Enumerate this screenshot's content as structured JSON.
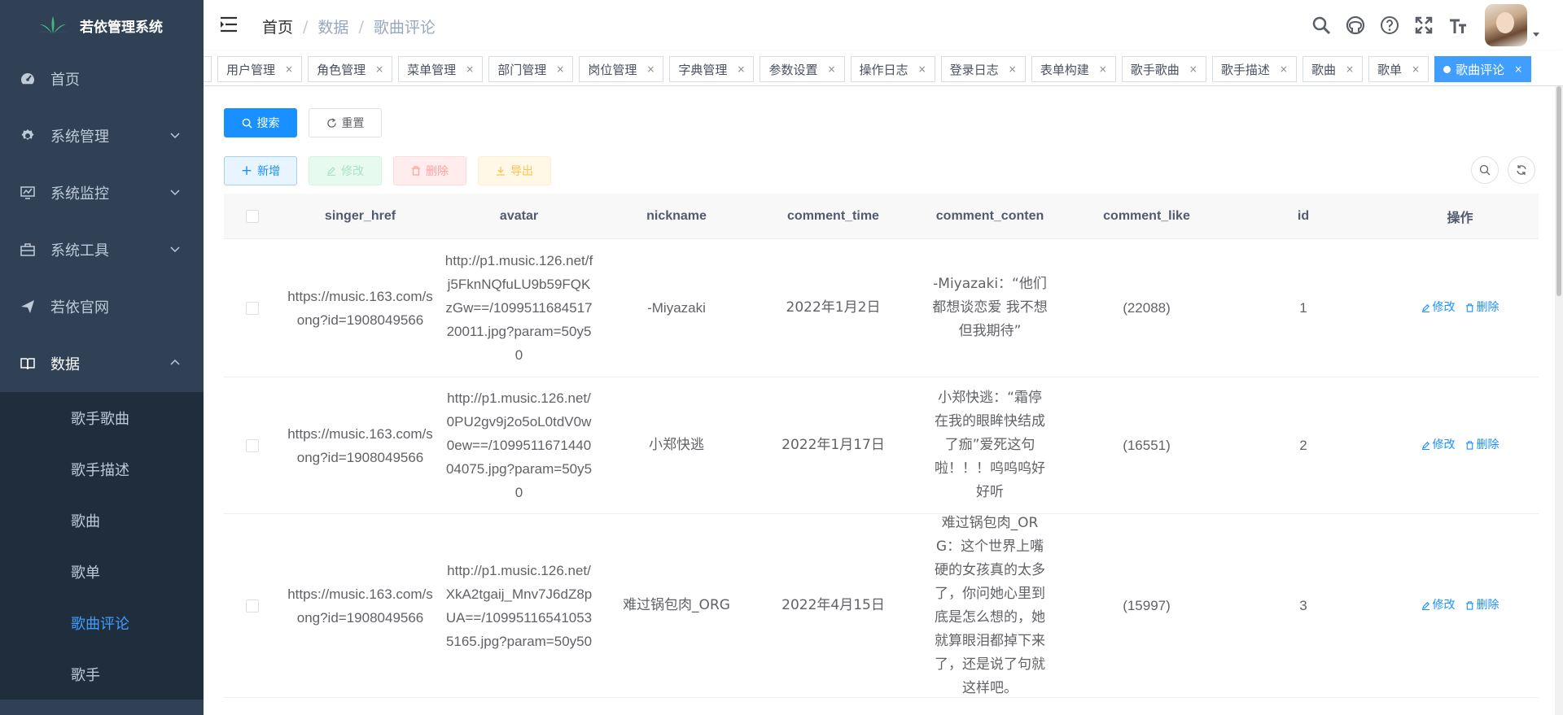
{
  "app": {
    "title": "若依管理系统"
  },
  "sidebar": {
    "items": [
      {
        "label": "首页",
        "icon": "dashboard-icon"
      },
      {
        "label": "系统管理",
        "icon": "gear-icon"
      },
      {
        "label": "系统监控",
        "icon": "monitor-icon"
      },
      {
        "label": "系统工具",
        "icon": "toolbox-icon"
      },
      {
        "label": "若依官网",
        "icon": "send-icon"
      },
      {
        "label": "数据",
        "icon": "book-icon"
      }
    ],
    "submenu": [
      "歌手歌曲",
      "歌手描述",
      "歌曲",
      "歌单",
      "歌曲评论",
      "歌手"
    ]
  },
  "breadcrumb": {
    "first": "首页",
    "sep": "/",
    "mid": "数据",
    "last": "歌曲评论"
  },
  "tags": [
    "用户管理",
    "角色管理",
    "菜单管理",
    "部门管理",
    "岗位管理",
    "字典管理",
    "参数设置",
    "操作日志",
    "登录日志",
    "表单构建",
    "歌手歌曲",
    "歌手描述",
    "歌曲",
    "歌单",
    "歌曲评论"
  ],
  "search": {
    "search_label": "搜索",
    "reset_label": "重置"
  },
  "toolbar": {
    "add_label": "新增",
    "edit_label": "修改",
    "delete_label": "删除",
    "export_label": "导出"
  },
  "table": {
    "headers": [
      "singer_href",
      "avatar",
      "nickname",
      "comment_time",
      "comment_conten",
      "comment_like",
      "id",
      "操作"
    ],
    "rows": [
      {
        "singer_href": "https://music.163.com/song?id=1908049566",
        "avatar": "http://p1.music.126.net/fj5FknNQfuLU9b59FQKzGw==/109951168451720011.jpg?param=50y50",
        "nickname": "-Miyazaki",
        "comment_time": "2022年1月2日",
        "comment_conten": "-Miyazaki：“他们都想谈恋爱 我不想 但我期待”",
        "comment_like": "(22088)",
        "id": "1"
      },
      {
        "singer_href": "https://music.163.com/song?id=1908049566",
        "avatar": "http://p1.music.126.net/0PU2gv9j2o5oL0tdV0w0ew==/109951167144004075.jpg?param=50y50",
        "nickname": "小郑快逃",
        "comment_time": "2022年1月17日",
        "comment_conten": "小郑快逃：“霜停在我的眼眸快结成了痂”爱死这句啦！！！呜呜呜好好听",
        "comment_like": "(16551)",
        "id": "2"
      },
      {
        "singer_href": "https://music.163.com/song?id=1908049566",
        "avatar": "http://p1.music.126.net/XkA2tgaij_Mnv7J6dZ8pUA==/109951165410535165.jpg?param=50y50",
        "nickname": "难过锅包肉_ORG",
        "comment_time": "2022年4月15日",
        "comment_conten": "难过锅包肉_ORG：这个世界上嘴硬的女孩真的太多了，你问她心里到底是怎么想的，她就算眼泪都掉下来了，还是说了句就这样吧。",
        "comment_like": "(15997)",
        "id": "3"
      }
    ],
    "row_actions": {
      "edit": "修改",
      "delete": "删除"
    }
  },
  "colors": {
    "sidebar_bg": "#304156",
    "submenu_bg": "#1f2d3d",
    "accent": "#1890ff",
    "active_tag": "#409eff"
  }
}
